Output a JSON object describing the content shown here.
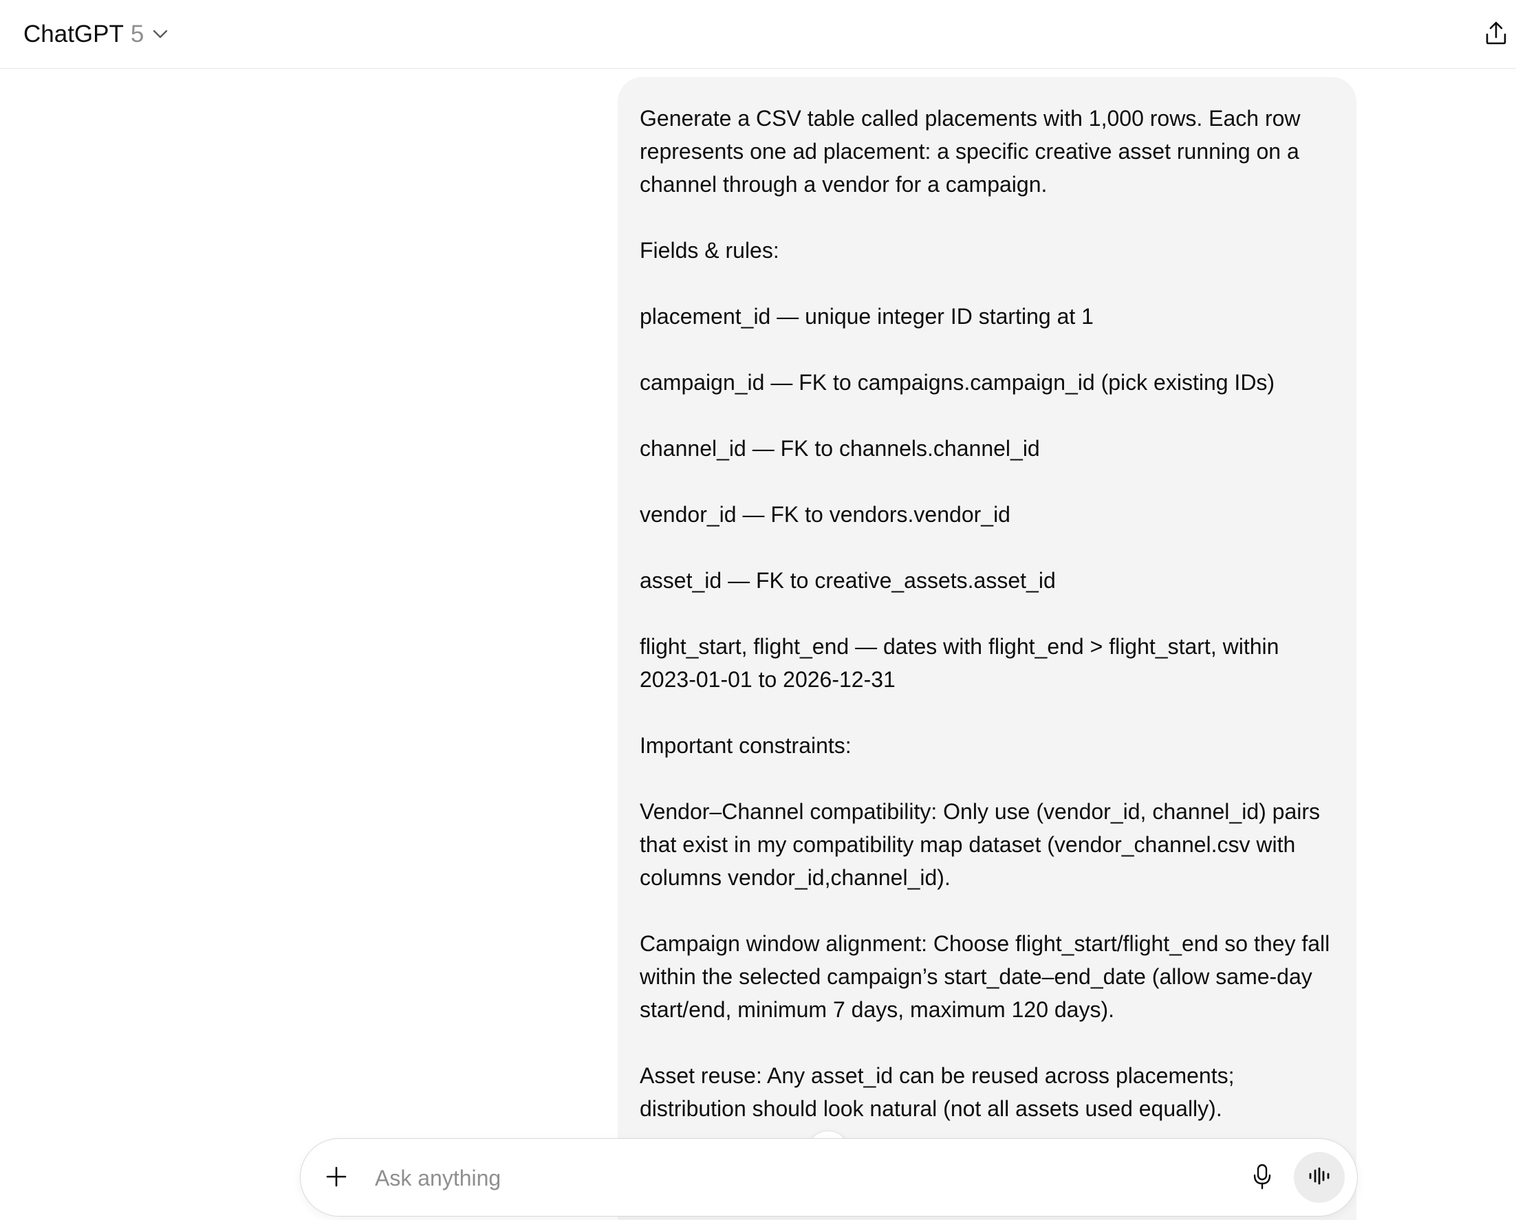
{
  "header": {
    "app_name": "ChatGPT",
    "model_version": "5",
    "icons": {
      "model_dropdown": "chevron-down-icon",
      "share": "share-icon"
    }
  },
  "conversation": {
    "user_message": {
      "paragraphs": [
        "Generate a CSV table called placements with 1,000 rows. Each row represents one ad placement: a specific creative asset running on a channel through a vendor for a campaign.",
        "Fields & rules:",
        "placement_id — unique integer ID starting at 1",
        "campaign_id — FK to campaigns.campaign_id (pick existing IDs)",
        "channel_id — FK to channels.channel_id",
        "vendor_id — FK to vendors.vendor_id",
        "asset_id — FK to creative_assets.asset_id",
        "flight_start, flight_end — dates with flight_end > flight_start, within 2023-01-01 to 2026-12-31",
        "Important constraints:",
        "Vendor–Channel compatibility: Only use (vendor_id, channel_id) pairs that exist in my compatibility map dataset (vendor_channel.csv with columns vendor_id,channel_id).",
        "Campaign window alignment: Choose flight_start/flight_end so they fall within the selected campaign’s start_date–end_date (allow same-day start/end, minimum 7 days, maximum 120 days).",
        "Asset reuse: Any asset_id can be reused across placements; distribution should look natural (not all assets used equally)."
      ]
    },
    "scroll_down_icon": "arrow-down-icon"
  },
  "composer": {
    "placeholder": "Ask anything",
    "value": "",
    "icons": {
      "attach": "plus-icon",
      "dictate": "microphone-icon",
      "voice_mode": "voice-waveform-icon"
    }
  }
}
